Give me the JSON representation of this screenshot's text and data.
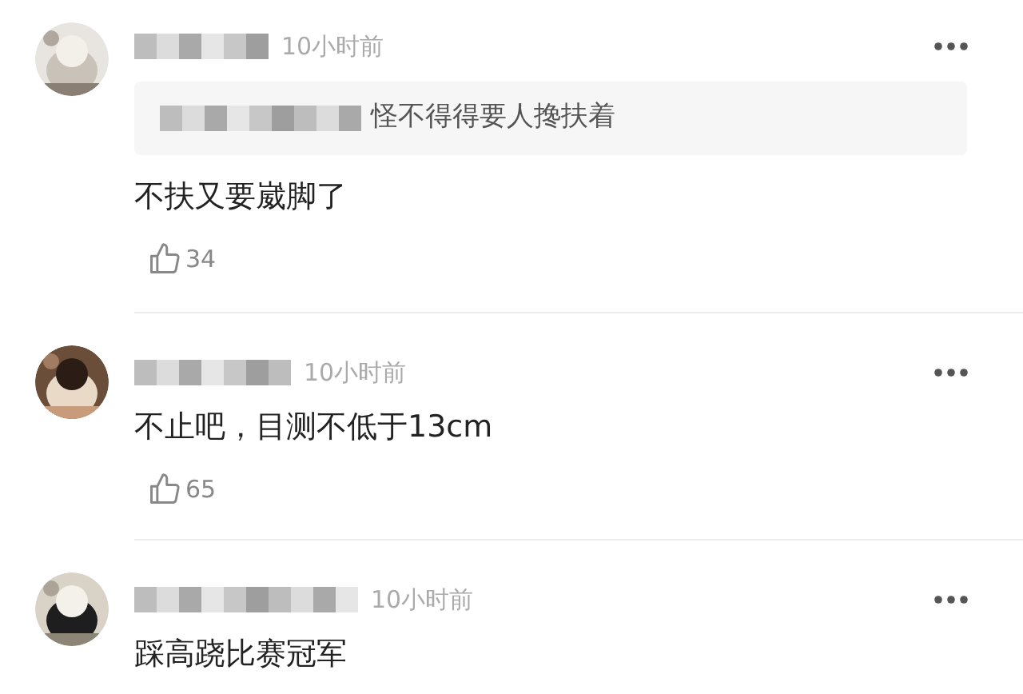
{
  "comments": [
    {
      "time": "10小时前",
      "quote": "怪不得得要人搀扶着",
      "text": "不扶又要崴脚了",
      "likes": "34"
    },
    {
      "time": "10小时前",
      "text": "不止吧，目测不低于13cm",
      "likes": "65"
    },
    {
      "time": "10小时前",
      "text": "踩高跷比赛冠军"
    }
  ]
}
